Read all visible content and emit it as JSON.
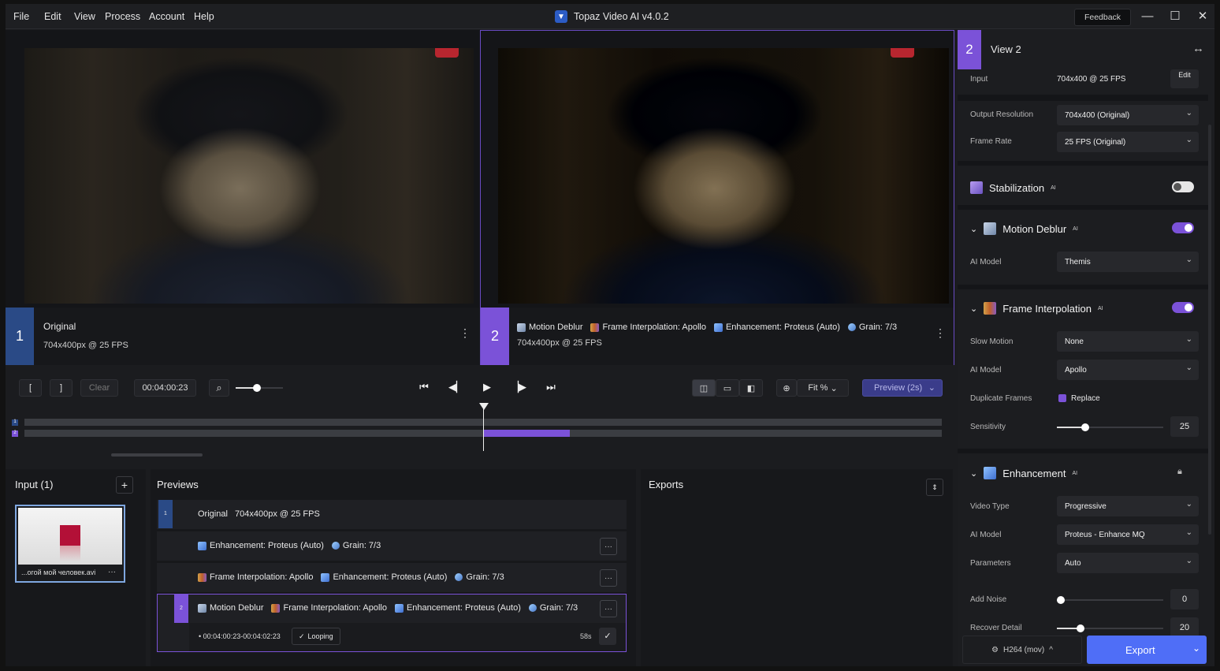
{
  "menu": {
    "file": "File",
    "edit": "Edit",
    "view": "View",
    "process": "Process",
    "account": "Account",
    "help": "Help"
  },
  "app_title": "Topaz Video AI  v4.0.2",
  "feedback_label": "Feedback",
  "viewers": [
    {
      "number": "1",
      "title": "Original",
      "meta": "704x400px @ 25 FPS"
    },
    {
      "number": "2",
      "filters": [
        "Motion Deblur",
        "Frame Interpolation: Apollo",
        "Enhancement: Proteus (Auto)",
        "Grain: 7/3"
      ],
      "meta": "704x400px @ 25 FPS"
    }
  ],
  "transport": {
    "mark_in": "[",
    "mark_out": "]",
    "clear": "Clear",
    "timecode": "00:04:00:23",
    "zoom_fit": "Fit %",
    "preview_label": "Preview (2s)",
    "zoom_level": 0.45
  },
  "timeline": {
    "track1": "1",
    "track2": "2"
  },
  "input_panel": {
    "title": "Input (1)",
    "add": "+",
    "file_name": "...огой мой человек.avi",
    "more": "···"
  },
  "previews": {
    "title": "Previews",
    "rows": [
      {
        "num": "1",
        "label": "Original",
        "meta": "704x400px @ 25 FPS"
      },
      {
        "filters": [
          "Enhancement: Proteus (Auto)",
          "Grain: 7/3"
        ],
        "menu": "···"
      },
      {
        "filters": [
          "Frame Interpolation: Apollo",
          "Enhancement: Proteus (Auto)",
          "Grain: 7/3"
        ],
        "menu": "···"
      },
      {
        "num": "2",
        "filters": [
          "Motion Deblur",
          "Frame Interpolation: Apollo",
          "Enhancement: Proteus (Auto)",
          "Grain: 7/3"
        ],
        "menu": "···"
      }
    ],
    "range": "00:04:00:23-00:04:02:23",
    "looping": "Looping",
    "duration": "58s"
  },
  "exports": {
    "title": "Exports"
  },
  "right_panel": {
    "view_num": "2",
    "view_title": "View 2",
    "input_label": "Input",
    "input_value": "704x400 @ 25 FPS",
    "edit": "Edit",
    "output_res_label": "Output Resolution",
    "output_res_value": "704x400 (Original)",
    "frame_rate_label": "Frame Rate",
    "frame_rate_value": "25 FPS (Original)",
    "stabilization": {
      "title": "Stabilization",
      "ai": "AI",
      "on": false
    },
    "motion_deblur": {
      "title": "Motion Deblur",
      "ai": "AI",
      "on": true,
      "model_label": "AI Model",
      "model": "Themis"
    },
    "frame_interp": {
      "title": "Frame Interpolation",
      "ai": "AI",
      "on": true,
      "slow_label": "Slow Motion",
      "slow": "None",
      "model_label": "AI Model",
      "model": "Apollo",
      "dup_label": "Duplicate Frames",
      "dup": "Replace",
      "sens_label": "Sensitivity",
      "sens": "25"
    },
    "enhancement": {
      "title": "Enhancement",
      "ai": "AI",
      "type_label": "Video Type",
      "type": "Progressive",
      "model_label": "AI Model",
      "model": "Proteus - Enhance MQ",
      "params_label": "Parameters",
      "params": "Auto",
      "noise_label": "Add Noise",
      "noise": "0",
      "recover_label": "Recover Detail",
      "recover": "20"
    },
    "codec": "H264 (mov)",
    "export": "Export"
  },
  "colors": {
    "accent": "#7b52d8",
    "view1": "#2a4a86",
    "export_btn": "#4f6ef7"
  }
}
